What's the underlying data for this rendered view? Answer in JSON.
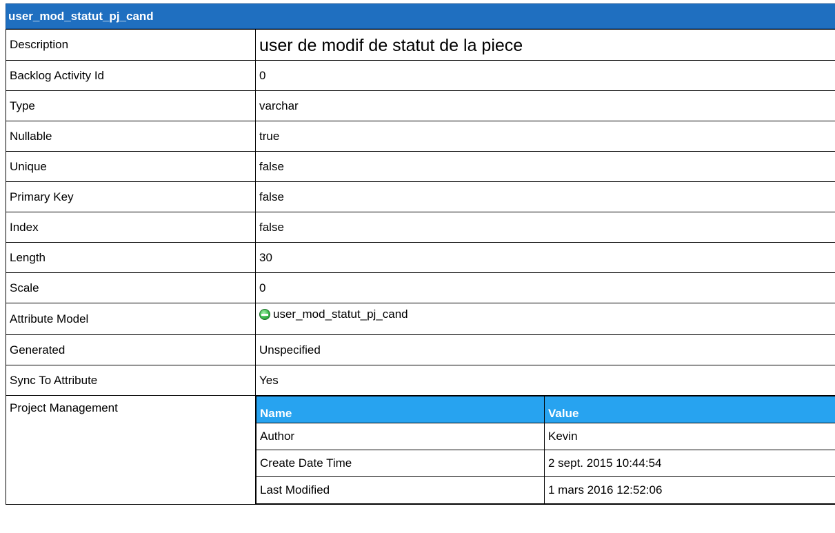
{
  "title": "user_mod_statut_pj_cand",
  "rows": [
    {
      "label": "Description",
      "value": "user de modif de statut de la piece"
    },
    {
      "label": "Backlog Activity Id",
      "value": "0"
    },
    {
      "label": "Type",
      "value": "varchar"
    },
    {
      "label": "Nullable",
      "value": "true"
    },
    {
      "label": "Unique",
      "value": "false"
    },
    {
      "label": "Primary Key",
      "value": "false"
    },
    {
      "label": "Index",
      "value": "false"
    },
    {
      "label": "Length",
      "value": "30"
    },
    {
      "label": "Scale",
      "value": "0"
    },
    {
      "label": "Attribute Model",
      "value": "user_mod_statut_pj_cand",
      "icon": "attribute-model-icon"
    },
    {
      "label": "Generated",
      "value": "Unspecified"
    },
    {
      "label": "Sync To Attribute",
      "value": "Yes"
    }
  ],
  "project_management": {
    "label": "Project Management",
    "headers": [
      "Name",
      "Value"
    ],
    "rows": [
      {
        "name": "Author",
        "value": "Kevin"
      },
      {
        "name": "Create Date Time",
        "value": "2 sept. 2015 10:44:54"
      },
      {
        "name": "Last Modified",
        "value": "1 mars 2016 12:52:06"
      }
    ]
  },
  "colors": {
    "title_bar": "#1f6fc0",
    "pm_header": "#27a3f0",
    "icon": "#3cba4e"
  }
}
